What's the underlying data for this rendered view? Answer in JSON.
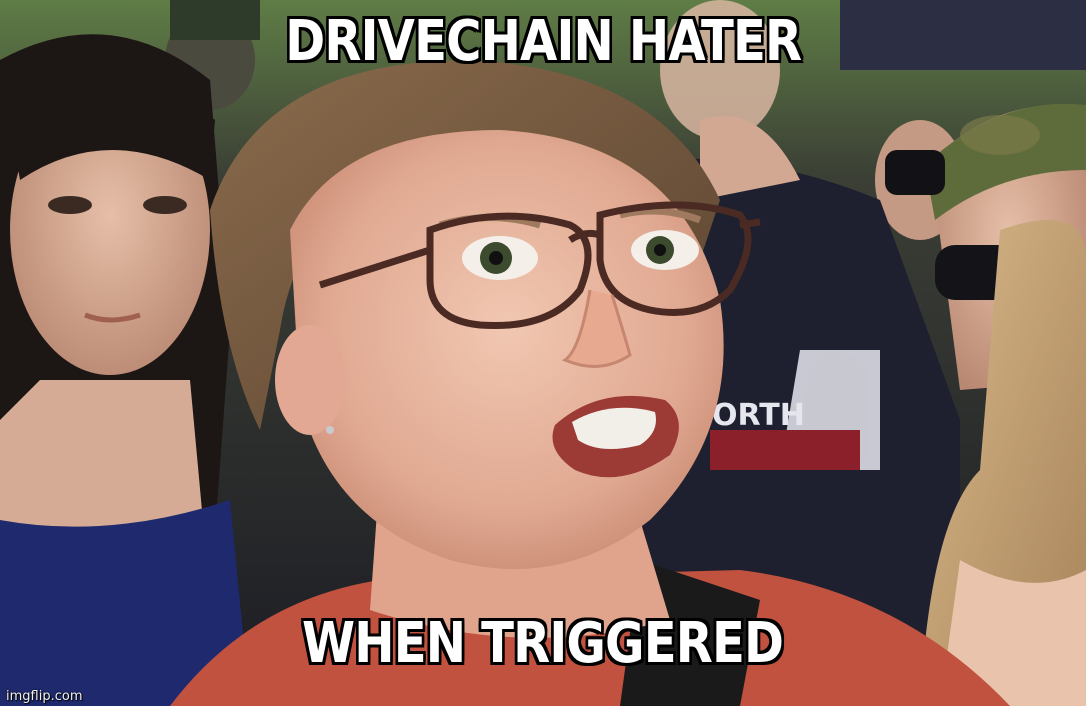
{
  "meme": {
    "top_text": "DRIVECHAIN HATER",
    "bottom_text": "WHEN TRIGGERED",
    "watermark": "imgflip.com"
  },
  "colors": {
    "caption_fill": "#ffffff",
    "caption_outline": "#000000",
    "skin": "#e8b9a2",
    "shirt_red": "#c0523f",
    "sky_green": "#6f8f4a"
  }
}
